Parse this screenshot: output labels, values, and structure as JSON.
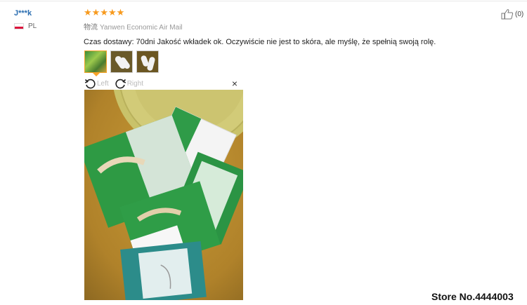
{
  "reviewer": {
    "name": "J***k",
    "country_code": "PL"
  },
  "review": {
    "rating": 5,
    "shipping_label": "物流",
    "shipping_method": "Yanwen Economic Air Mail",
    "text": "Czas dostawy: 70dni Jakość wkładek ok. Oczywiście nie jest to skóra, ale myślę, że spełnią swoją rolę.",
    "helpful_count": "(0)"
  },
  "colors": {
    "star": "#f79a1e",
    "name": "#2a6db0",
    "active_thumb": "#f7a32a"
  },
  "viewer": {
    "rotate_left_label": "Left",
    "rotate_right_label": "Right",
    "close_label": "×",
    "thumbnail_count": 3
  },
  "watermark": "Store No.4444003"
}
